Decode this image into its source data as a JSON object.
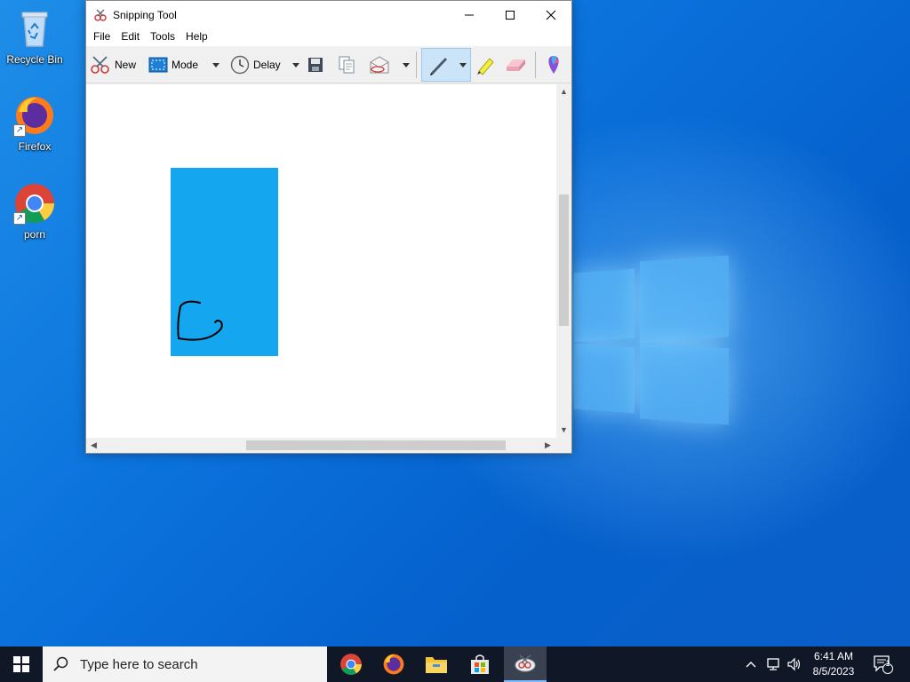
{
  "desktop": {
    "icons": [
      {
        "label": "Recycle Bin",
        "icon": "recycle-bin-icon"
      },
      {
        "label": "Firefox",
        "icon": "firefox-icon"
      },
      {
        "label": "porn",
        "icon": "chrome-icon"
      }
    ]
  },
  "window": {
    "title": "Snipping Tool",
    "menu": [
      "File",
      "Edit",
      "Tools",
      "Help"
    ],
    "toolbar": {
      "new_label": "New",
      "mode_label": "Mode",
      "delay_label": "Delay"
    }
  },
  "taskbar": {
    "search_placeholder": "Type here to search",
    "time": "6:41 AM",
    "date": "8/5/2023",
    "notification_count": "1"
  },
  "colors": {
    "snip_fill": "#15a6f0",
    "taskbar": "#101828",
    "accent": "#0078d7"
  }
}
